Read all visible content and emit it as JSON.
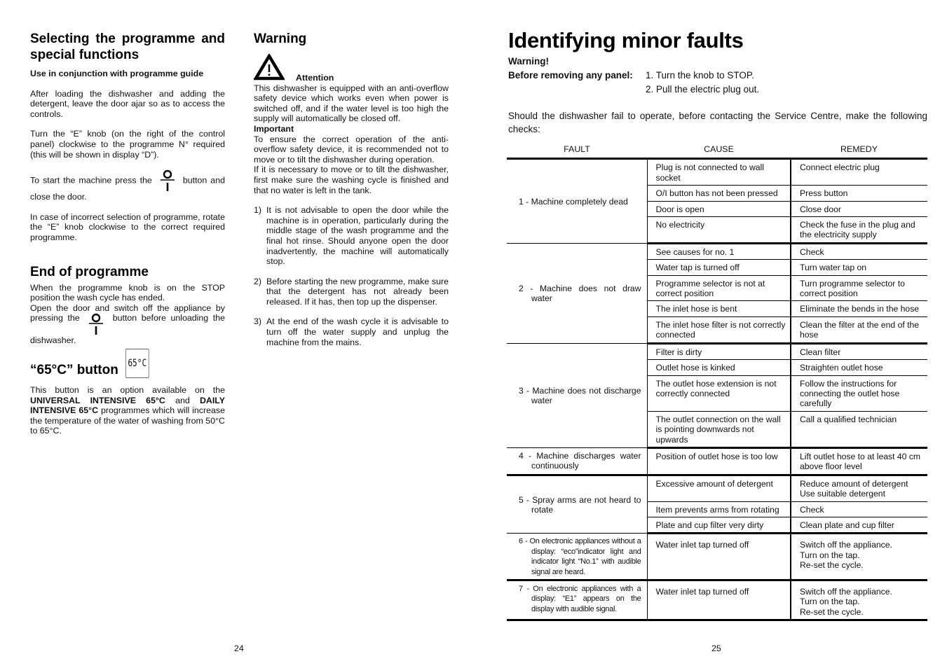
{
  "page_left": {
    "number": "24",
    "selecting": {
      "heading": "Selecting the programme  and special functions",
      "subheading": "Use in conjunction with programme guide",
      "p1": "After loading the dishwasher and adding the detergent, leave the door ajar so as to access the controls.",
      "p2": "Turn the “E” knob (on the right of the control panel) clockwise to the programme N° required (this will be shown in display “D”).",
      "p3_before": "To start the machine press the",
      "p3_after": "button and close the door.",
      "p4": "In case of incorrect selection of programme, rotate the “E” knob clockwise to the correct required programme."
    },
    "end_of_programme": {
      "heading": "End of programme",
      "p1": "When the programme knob is on the STOP position the wash cycle has ended.",
      "p2_before": "Open the door and switch off the appliance by pressing the",
      "p2_after": "button before unloading the dishwasher."
    },
    "button65": {
      "heading": "“65°C” button",
      "icon_label": "65°C",
      "p_part1": "This button is an option available on the ",
      "bold1": "UNIVERSAL INTENSIVE 65°C",
      "p_part2": " and ",
      "bold2": "DAILY INTENSIVE 65°C",
      "p_part3": " programmes which will increase the temperature of the water of washing from 50°C to 65°C."
    },
    "warning": {
      "heading": "Warning",
      "attention": "Attention",
      "attention_text": "This dishwasher is equipped with an anti-overflow safety device which works even when power is switched off, and if the water level is too high the supply will automatically be closed off.",
      "important": "Important",
      "important_text1": "To ensure the correct operation of the anti-overflow safety device, it is recommended not to move or to tilt the dishwasher during operation.",
      "important_text2": "If it is necessary to move or to tilt the dishwasher, first make sure the washing cycle is finished and that no water is left in the tank.",
      "items": [
        {
          "num": "1)",
          "text": "It is not advisable to open the  door while the machine is in operation, particularly during the middle stage of the wash programme and the final hot rinse. Should anyone open the door inadvertently,  the machine will automatically stop."
        },
        {
          "num": "2)",
          "text": "Before starting the new programme, make sure that the detergent has not already been released. If it has, then top up the dispenser."
        },
        {
          "num": "3)",
          "text": "At the end of the wash cycle it is advisable to turn off the water supply and unplug the machine from the mains."
        }
      ]
    }
  },
  "page_right": {
    "number": "25",
    "title": "Identifying minor faults",
    "warning_label": "Warning!",
    "before_label": "Before removing any panel:",
    "steps": [
      "1. Turn the knob to STOP.",
      "2. Pull the electric plug out."
    ],
    "intro": "Should the dishwasher fail to operate, before contacting the Service Centre, make the following checks:",
    "table": {
      "headers": [
        "FAULT",
        "CAUSE",
        "REMEDY"
      ],
      "groups": [
        {
          "fault": "1 - Machine completely dead",
          "rows": [
            {
              "cause": "Plug is not connected to wall socket",
              "remedy": "Connect electric plug"
            },
            {
              "cause": "O/I button has not been pressed",
              "remedy": "Press button"
            },
            {
              "cause": "Door is open",
              "remedy": "Close door"
            },
            {
              "cause": "No electricity",
              "remedy": "Check the fuse in the plug and the electricity supply"
            }
          ]
        },
        {
          "fault": "2 - Machine does not draw water",
          "rows": [
            {
              "cause": "See causes for no. 1",
              "remedy": "Check"
            },
            {
              "cause": "Water tap is turned off",
              "remedy": "Turn water tap on"
            },
            {
              "cause": "Programme selector is not at correct position",
              "remedy": "Turn programme selector to correct position"
            },
            {
              "cause": "The inlet hose is bent",
              "remedy": "Eliminate the bends in the hose"
            },
            {
              "cause": "The inlet hose filter is not correctly connected",
              "remedy": "Clean the filter at the end of the hose"
            }
          ]
        },
        {
          "fault": "3 - Machine does not discharge water",
          "rows": [
            {
              "cause": "Filter is dirty",
              "remedy": "Clean filter"
            },
            {
              "cause": "Outlet hose is kinked",
              "remedy": "Straighten outlet hose"
            },
            {
              "cause": "The outlet hose extension is not correctly connected",
              "remedy": "Follow the instructions for connecting the outlet hose carefully"
            },
            {
              "cause": "The outlet connection on the wall is pointing downwards not upwards",
              "remedy": "Call a qualified technician"
            }
          ]
        },
        {
          "fault": "4 - Machine discharges water continuously",
          "rows": [
            {
              "cause": "Position of outlet hose is too low",
              "remedy": "Lift outlet hose to at least 40 cm above floor level"
            }
          ]
        },
        {
          "fault": "5 - Spray arms are not heard to rotate",
          "rows": [
            {
              "cause": "Excessive amount of detergent",
              "remedy": "Reduce amount of detergent\nUse suitable detergent"
            },
            {
              "cause": "Item prevents arms from rotating",
              "remedy": "Check"
            },
            {
              "cause": "Plate and cup filter very dirty",
              "remedy": "Clean plate and cup filter"
            }
          ]
        },
        {
          "fault": "6 - On electronic appliances without a display: “eco”indicator light  and indicator light “No.1” with audible signal are heard.",
          "small": true,
          "rows": [
            {
              "cause": "Water inlet tap turned off",
              "remedy": "Switch off the appliance.\nTurn on the tap.\nRe-set the cycle."
            }
          ]
        },
        {
          "fault": "7 - On electronic appliances with a display: “E1” appears on the display with audible signal.",
          "small": true,
          "rows": [
            {
              "cause": "Water inlet tap turned off",
              "remedy": "Switch off the appliance.\nTurn on the tap.\nRe-set the cycle."
            }
          ]
        }
      ]
    }
  }
}
